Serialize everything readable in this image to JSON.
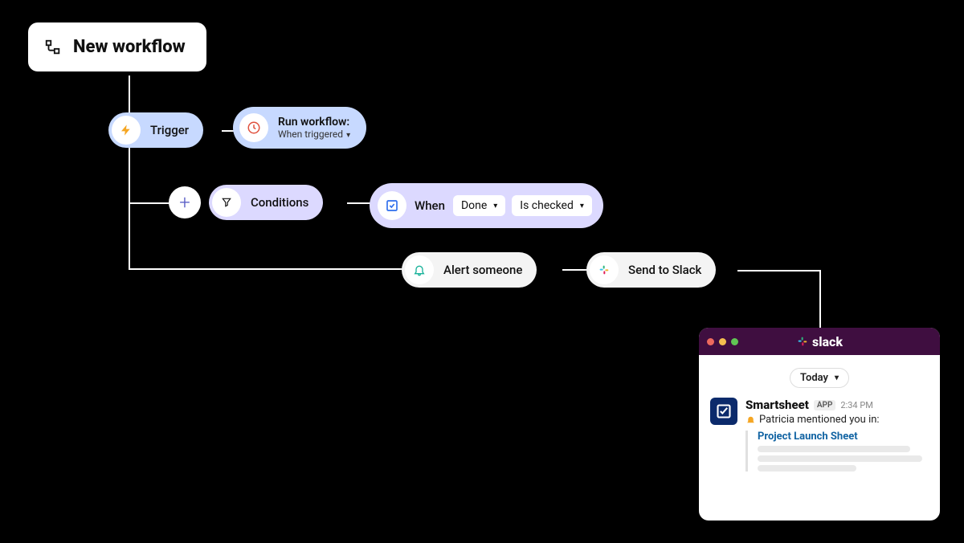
{
  "title": "New workflow",
  "trigger": {
    "label": "Trigger",
    "run_title": "Run workflow:",
    "run_sub": "When triggered"
  },
  "conditions": {
    "label": "Conditions",
    "lead": "When",
    "field": "Done",
    "op": "Is checked"
  },
  "alert": {
    "label": "Alert someone"
  },
  "slack_action": {
    "label": "Send to Slack"
  },
  "slack_win": {
    "brand": "slack",
    "today": "Today",
    "sender": "Smartsheet",
    "app_badge": "APP",
    "time": "2:34 PM",
    "mention": "Patricia mentioned you in:",
    "link": "Project Launch Sheet"
  },
  "colors": {
    "blue_pill": "#c7d9ff",
    "purple_pill": "#dcd9ff",
    "grey_pill": "#f4f4f4",
    "slack_purple": "#3f0e40"
  }
}
